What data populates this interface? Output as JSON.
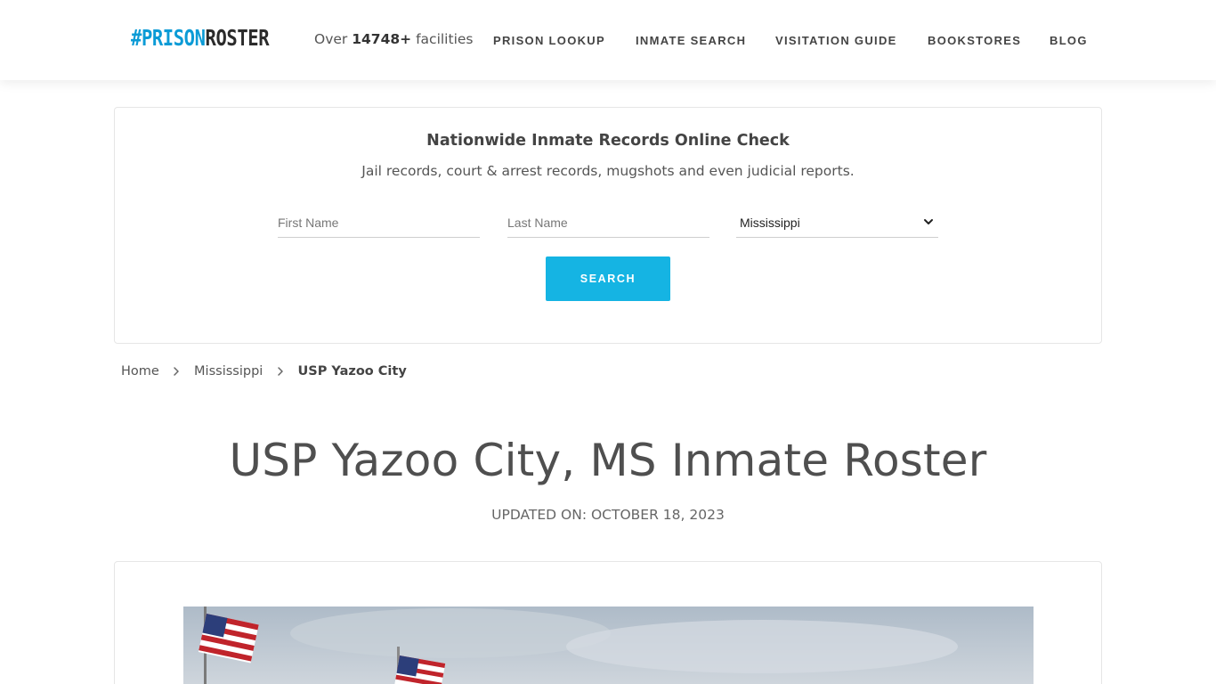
{
  "header": {
    "logo_hash": "#",
    "logo_prison": "PRISON",
    "logo_roster": "ROSTER",
    "facilities_prefix": "Over",
    "facilities_count": "14748+",
    "facilities_suffix": "facilities",
    "nav": [
      {
        "label": "PRISON LOOKUP"
      },
      {
        "label": "INMATE SEARCH"
      },
      {
        "label": "VISITATION GUIDE"
      },
      {
        "label": "BOOKSTORES"
      },
      {
        "label": "BLOG"
      }
    ]
  },
  "search": {
    "title": "Nationwide Inmate Records Online Check",
    "subtitle": "Jail records, court & arrest records, mugshots and even judicial reports.",
    "first_name_placeholder": "First Name",
    "last_name_placeholder": "Last Name",
    "state_selected": "Mississippi",
    "button_label": "SEARCH"
  },
  "breadcrumb": {
    "home": "Home",
    "state": "Mississippi",
    "current": "USP Yazoo City"
  },
  "page": {
    "title": "USP Yazoo City, MS Inmate Roster",
    "updated": "UPDATED ON: OCTOBER 18, 2023"
  },
  "colors": {
    "brand_blue": "#0b9bd6",
    "button_blue": "#15b4e3"
  },
  "icons": {
    "breadcrumb_separator": "chevron-right-icon",
    "select_arrow": "chevron-down-icon"
  }
}
